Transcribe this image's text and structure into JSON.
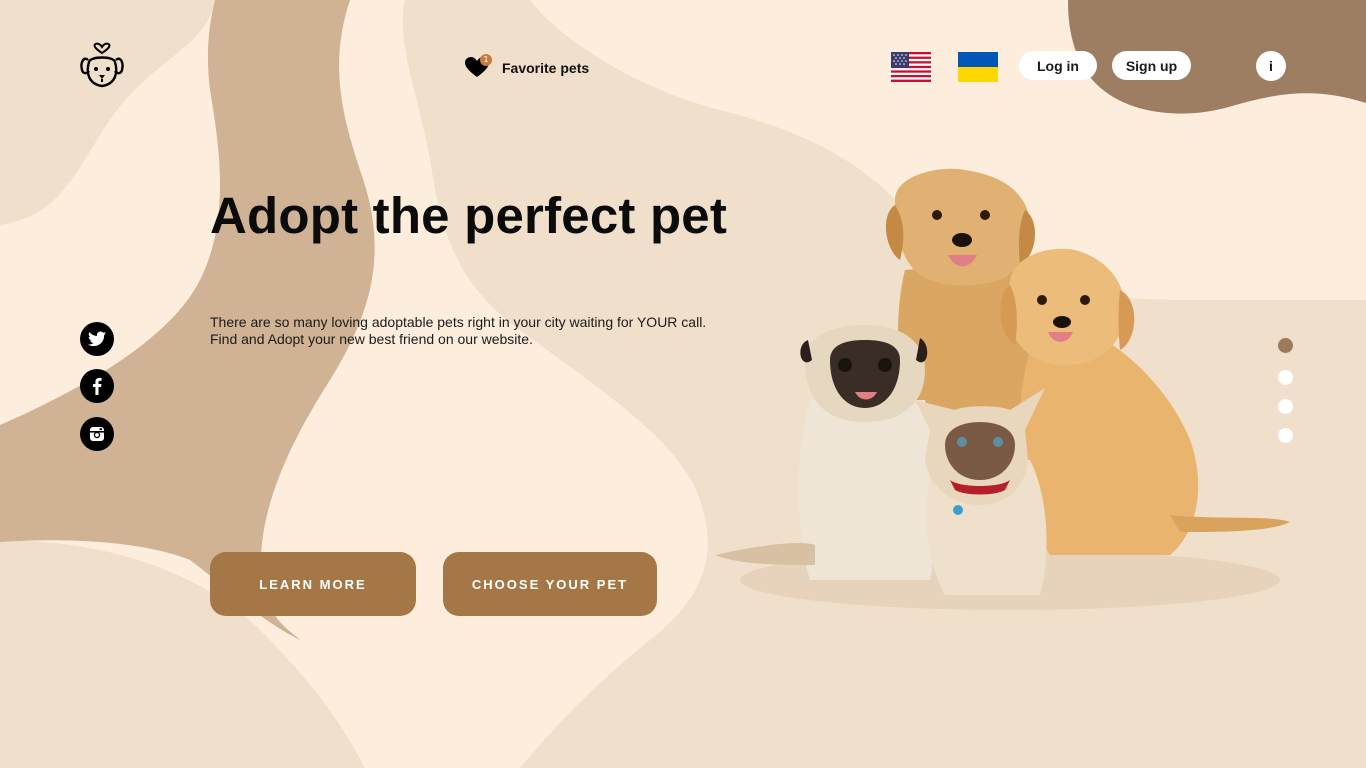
{
  "header": {
    "logo_icon": "dog-heart-logo-icon",
    "favorites": {
      "label": "Favorite pets",
      "count": "1",
      "icon": "heart-icon"
    },
    "languages": [
      {
        "name": "English",
        "icon": "us-flag-icon"
      },
      {
        "name": "Ukrainian",
        "icon": "ukraine-flag-icon"
      }
    ],
    "login_label": "Log in",
    "signup_label": "Sign up",
    "info_label": "i"
  },
  "hero": {
    "title": "Adopt the perfect pet",
    "description": "There are so many loving adoptable pets right in your city waiting for YOUR call. Find and Adopt your new best friend on our website.",
    "learn_more_label": "LEARN MORE",
    "choose_pet_label": "CHOOSE YOUR PET",
    "image": "pets-group-photo"
  },
  "social": [
    {
      "icon": "twitter-icon"
    },
    {
      "icon": "facebook-icon"
    },
    {
      "icon": "instagram-icon"
    }
  ],
  "slider": {
    "count": 4,
    "active_index": 0
  },
  "colors": {
    "background": "#fdeddd",
    "blob_light": "#f0dfca",
    "blob_dark": "#cfb394",
    "accent_brown": "#a57747",
    "top_right_blob": "#9e7e62",
    "active_dot": "#9c7b5b"
  }
}
